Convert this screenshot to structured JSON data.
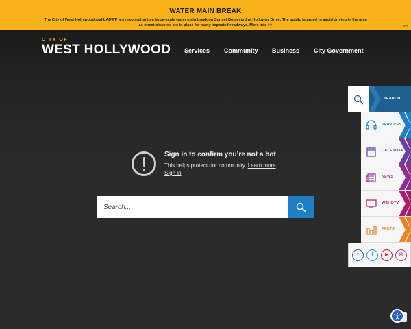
{
  "alert": {
    "title": "WATER MAIN BREAK",
    "text": "The City of West Hollywood and LADWP are responding to a large-scale water main break on Sunset Boulevard at Holloway Drive. The public is urged to avoid driving in the area as street closures are in place for many impacted roadways.",
    "link": "More info >>",
    "toggle_icon": "chevron-up-double-icon"
  },
  "logo": {
    "small": "CITY OF",
    "big": "WEST HOLLYWOOD"
  },
  "nav": [
    {
      "label": "Services"
    },
    {
      "label": "Community"
    },
    {
      "label": "Business"
    },
    {
      "label": "City Government"
    }
  ],
  "bot_check": {
    "title": "Sign in to confirm you’re not a bot",
    "desc": "This helps protect our community.",
    "learn_more": "Learn more",
    "sign_in": "Sign in"
  },
  "search": {
    "placeholder": "Search..."
  },
  "side": {
    "search_label": "SEARCH",
    "items": [
      {
        "label": "SERVICES",
        "icon": "headset-icon",
        "color": "#1e7ec8"
      },
      {
        "label": "CALENDAR",
        "icon": "calendar-icon",
        "color": "#6b3fa0"
      },
      {
        "label": "NEWS",
        "icon": "newspaper-icon",
        "color": "#8e2f8f"
      },
      {
        "label": "WEHOTV",
        "icon": "tv-icon",
        "color": "#a61f6b"
      },
      {
        "label": "FACTS",
        "icon": "bar-chart-icon",
        "color": "#e8832a"
      }
    ],
    "social": [
      {
        "icon": "facebook-icon",
        "glyph": "f",
        "color": "#3b5998"
      },
      {
        "icon": "twitter-icon",
        "glyph": "t",
        "color": "#1da1f2"
      },
      {
        "icon": "youtube-icon",
        "glyph": "▶",
        "color": "#cc181e"
      },
      {
        "icon": "instagram-icon",
        "glyph": "◎",
        "color": "#c13584"
      }
    ]
  },
  "colors": {
    "accent": "#f9b219",
    "search_blue": "#1e7ec8",
    "side_search": "#1f5f8f"
  }
}
